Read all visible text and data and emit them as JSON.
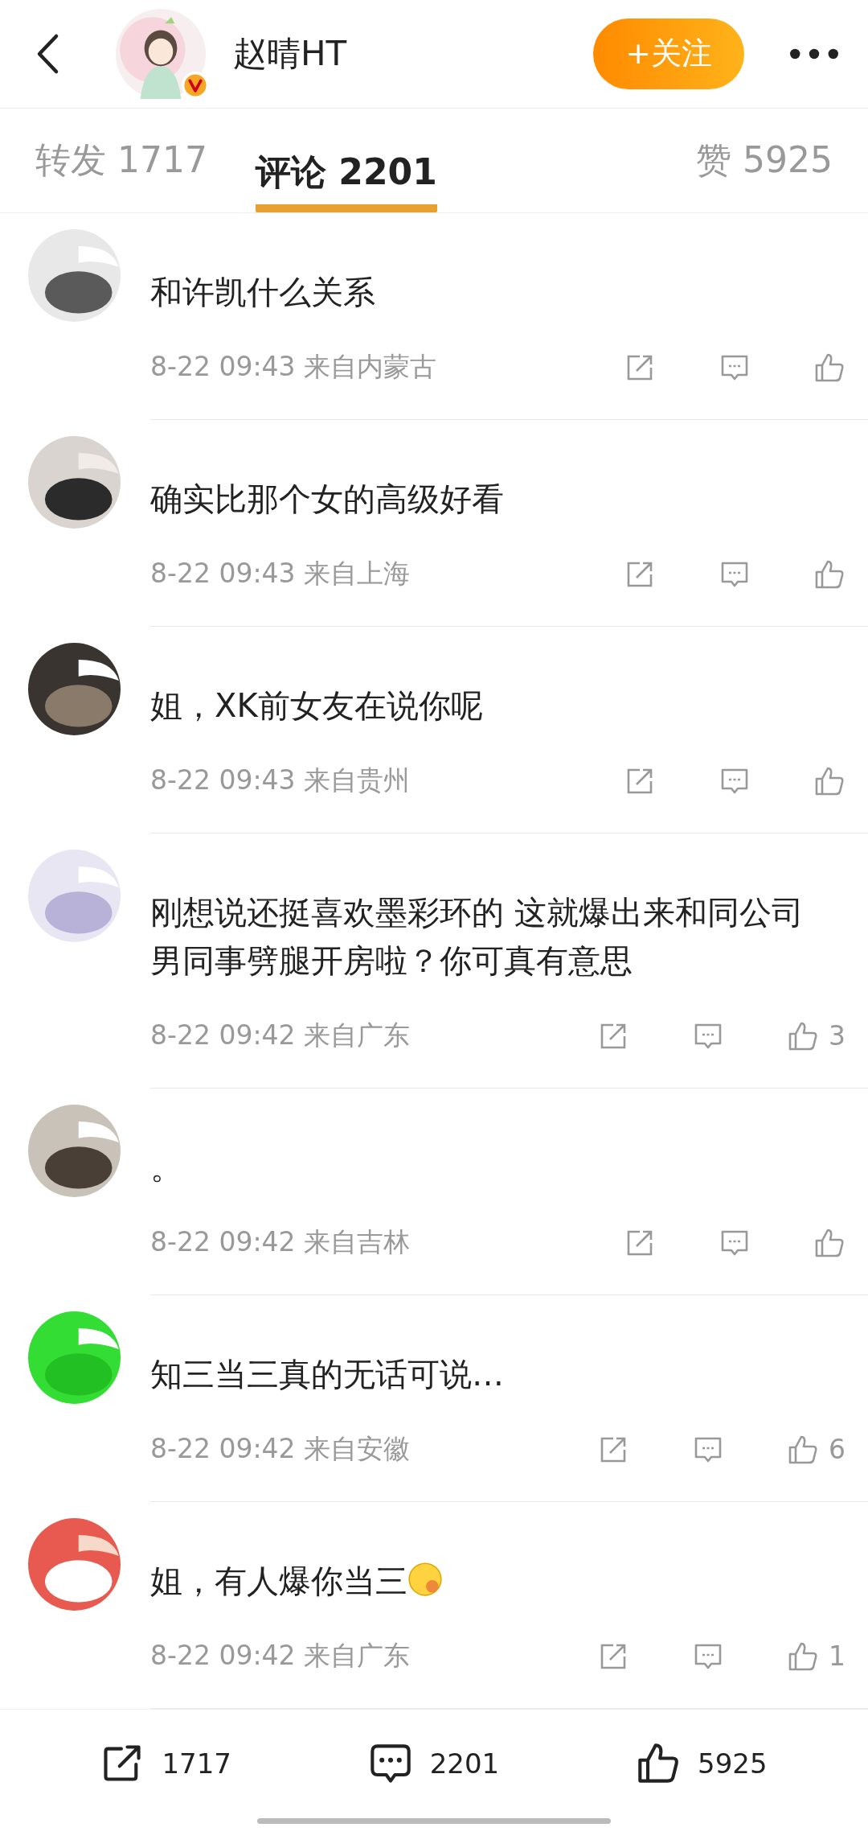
{
  "header": {
    "name": "赵晴HT",
    "verified": true,
    "follow_button": "+关注"
  },
  "tabs": [
    {
      "label": "转发 1717",
      "selected": false
    },
    {
      "label": "评论 2201",
      "selected": true
    },
    {
      "label": "赞 5925",
      "selected": false
    }
  ],
  "comments": [
    {
      "text": "和许凯什么关系",
      "time": "8-22 09:43",
      "location": "来自内蒙古"
    },
    {
      "text": "确实比那个女的高级好看",
      "time": "8-22 09:43",
      "location": "来自上海"
    },
    {
      "text": "姐，XK前女友在说你呢",
      "time": "8-22 09:43",
      "location": "来自贵州"
    },
    {
      "text": "刚想说还挺喜欢墨彩环的 这就爆出来和同公司男同事劈腿开房啦？你可真有意思",
      "time": "8-22 09:42",
      "location": "来自广东",
      "likes": "3"
    },
    {
      "text": "。",
      "time": "8-22 09:42",
      "location": "来自吉林"
    },
    {
      "text": "知三当三真的无话可说…",
      "time": "8-22 09:42",
      "location": "来自安徽",
      "likes": "6"
    },
    {
      "text": "姐，有人爆你当三",
      "emoji": true,
      "time": "8-22 09:42",
      "location": "来自广东",
      "likes": "1"
    }
  ],
  "bottom_bar": {
    "reposts": "1717",
    "comments": "2201",
    "likes": "5925"
  }
}
